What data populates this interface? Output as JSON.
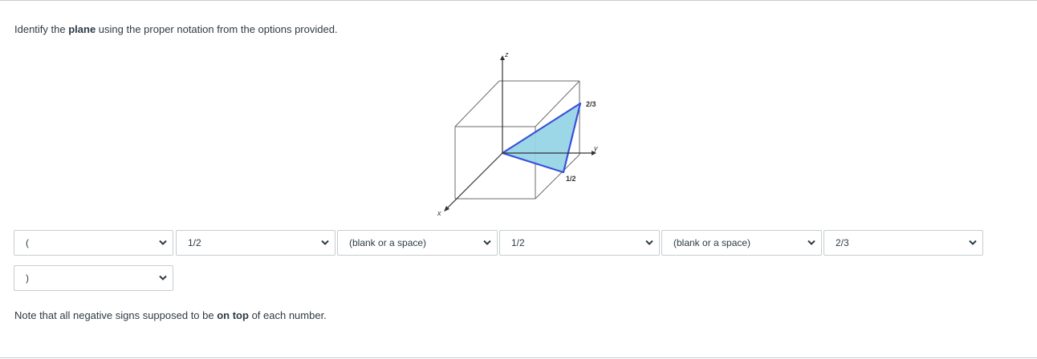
{
  "question": {
    "prefix": "Identify the ",
    "bold": "plane",
    "suffix": " using the proper notation from the options provided."
  },
  "figure": {
    "axis_labels": {
      "z": "z",
      "y": "y",
      "x": "x"
    },
    "intercept_labels": {
      "top": "2/3",
      "bottom": "1/2"
    },
    "plane_fill": "#96d5e6",
    "plane_edge": "#3a4fd8",
    "cube_color": "#6b6b6b"
  },
  "selects": [
    {
      "value": "("
    },
    {
      "value": "1/2"
    },
    {
      "value": "(blank or a space)"
    },
    {
      "value": "1/2"
    },
    {
      "value": "(blank or a space)"
    },
    {
      "value": "2/3"
    },
    {
      "value": ")"
    }
  ],
  "note": {
    "prefix": "Note that all negative signs supposed to be ",
    "bold": "on top",
    "suffix": " of each number."
  }
}
